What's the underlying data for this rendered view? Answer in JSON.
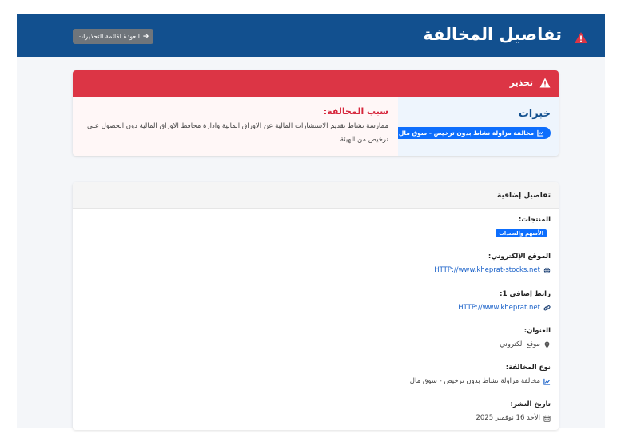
{
  "header": {
    "title": "تفاصيل المخالفة",
    "back_label": "العودة لقائمة التحذيرات",
    "bg_color": "#12508f"
  },
  "warning_card": {
    "header_label": "تحذير",
    "header_color": "#dc3545",
    "category": {
      "title": "خبرات",
      "badge": "مخالفة مزاولة نشاط بدون ترخيص - سوق مال"
    },
    "reason": {
      "title": "سبب المخالفة:",
      "text": "ممارسة نشاط تقديم الاستشارات المالية عن الاوراق المالية وادارة محافظ الاوراق المالية دون الحصول على ترخيص من الهيئة"
    }
  },
  "details_card": {
    "header_label": "تفاصيل إضافية",
    "products": {
      "label": "المنتجات:",
      "tag": "الأسهم والسندات"
    },
    "website": {
      "label": "الموقع الإلكتروني:",
      "value": "HTTP://www.kheprat-stocks.net"
    },
    "extra_link": {
      "label": "رابط إضافي 1:",
      "value": "HTTP://www.kheprat.net"
    },
    "address": {
      "label": "العنوان:",
      "value": "موقع الكتروني"
    },
    "violation_type": {
      "label": "نوع المخالفة:",
      "value": "مخالفة مزاولة نشاط بدون ترخيص - سوق مال"
    },
    "publish_date": {
      "label": "تاريخ النشر:",
      "value": "الأحد 16 نوفمبر 2025"
    }
  },
  "icons": {
    "title": "warning-triangle-icon",
    "back": "arrow-right-icon",
    "category_badge": "chart-line-icon",
    "website": "globe-icon",
    "extra_link": "link-icon",
    "address": "map-marker-icon",
    "violation_type": "chart-line-icon",
    "publish_date": "calendar-icon"
  }
}
